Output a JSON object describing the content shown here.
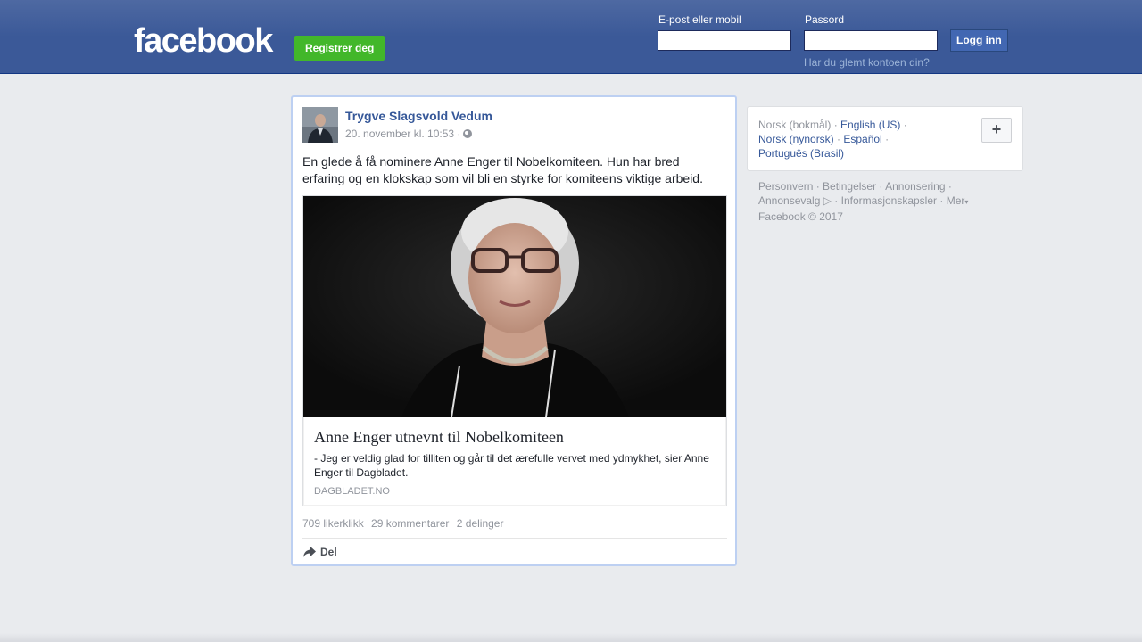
{
  "header": {
    "logo": "facebook",
    "register_label": "Registrer deg",
    "email_label": "E-post eller mobil",
    "password_label": "Passord",
    "login_label": "Logg inn",
    "forgot_label": "Har du glemt kontoen din?"
  },
  "post": {
    "author": "Trygve Slagsvold Vedum",
    "timestamp": "20. november kl. 10:53 ·",
    "privacy_icon": "globe-icon",
    "text": "En glede å få nominere Anne Enger til Nobelkomiteen. Hun har bred erfaring og en klokskap som vil bli en styrke for komiteens viktige arbeid.",
    "link": {
      "title": "Anne Enger utnevnt til Nobelkomiteen",
      "description": "- Jeg er veldig glad for tilliten og går til det ærefulle vervet med ydmykhet, sier Anne Enger til Dagbladet.",
      "domain": "DAGBLADET.NO"
    },
    "stats": {
      "likes": "709 likerklikk",
      "comments": "29 kommentarer",
      "shares": "2 delinger"
    },
    "share_label": "Del"
  },
  "languages": {
    "items": [
      {
        "label": "Norsk (bokmål)",
        "sep": " · "
      },
      {
        "label": "English (US)",
        "sep": " ·"
      },
      {
        "label": "Norsk (nynorsk)",
        "sep": " · "
      },
      {
        "label": "Español",
        "sep": " ·"
      },
      {
        "label": "Português (Brasil)",
        "sep": ""
      }
    ],
    "add_label": "+"
  },
  "footer": {
    "links": [
      "Personvern",
      "Betingelser",
      "Annonsering",
      "Annonsevalg",
      "Informasjonskapsler",
      "Mer"
    ],
    "copyright": "Facebook © 2017"
  },
  "colors": {
    "header_bg": "#3b5998",
    "register_green": "#42b72a",
    "link_blue": "#365899"
  }
}
